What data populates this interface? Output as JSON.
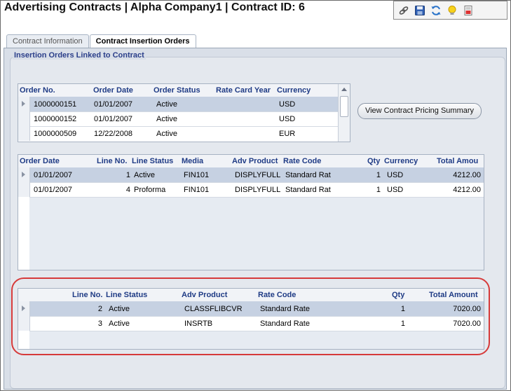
{
  "header": {
    "title": "Advertising Contracts  |  Alpha Company1 | Contract ID: 6"
  },
  "toolbar": {
    "icons": [
      "link-icon",
      "save-icon",
      "refresh-icon",
      "lightbulb-icon",
      "report-icon"
    ]
  },
  "tabs": [
    {
      "label": "Contract Information",
      "active": false
    },
    {
      "label": "Contract Insertion Orders",
      "active": true
    }
  ],
  "group": {
    "title": "Insertion Orders Linked to Contract"
  },
  "orders_grid": {
    "columns": [
      "Order No.",
      "Order Date",
      "Order Status",
      "Rate Card Year",
      "Currency"
    ],
    "rows": [
      [
        "1000000151",
        "01/01/2007",
        "Active",
        "",
        "USD"
      ],
      [
        "1000000152",
        "01/01/2007",
        "Active",
        "",
        "USD"
      ],
      [
        "1000000509",
        "12/22/2008",
        "Active",
        "",
        "EUR"
      ]
    ]
  },
  "pricing_button": {
    "label": "View Contract Pricing Summary"
  },
  "lines_grid": {
    "columns": [
      "Order Date",
      "Line No.",
      "Line Status",
      "Media",
      "Adv Product",
      "Rate Code",
      "Qty",
      "Currency",
      "Total Amou"
    ],
    "rows": [
      [
        "01/01/2007",
        "1",
        "Active",
        "FIN101",
        "DISPLYFULL",
        "Standard Rat",
        "1",
        "USD",
        "4212.00"
      ],
      [
        "01/01/2007",
        "4",
        "Proforma",
        "FIN101",
        "DISPLYFULL",
        "Standard Rat",
        "1",
        "USD",
        "4212.00"
      ]
    ]
  },
  "linked_grid": {
    "columns": [
      "Line No.",
      "Line Status",
      "Adv Product",
      "Rate Code",
      "Qty",
      "Total Amount"
    ],
    "rows": [
      [
        "2",
        "Active",
        "CLASSFLIBCVR",
        "Standard Rate",
        "1",
        "7020.00"
      ],
      [
        "3",
        "Active",
        "INSRTB",
        "Standard Rate",
        "1",
        "7020.00"
      ]
    ]
  },
  "colors": {
    "header_text": "#1f3b85",
    "selected_row": "#c6d1e2",
    "highlight": "#d63a3a"
  }
}
